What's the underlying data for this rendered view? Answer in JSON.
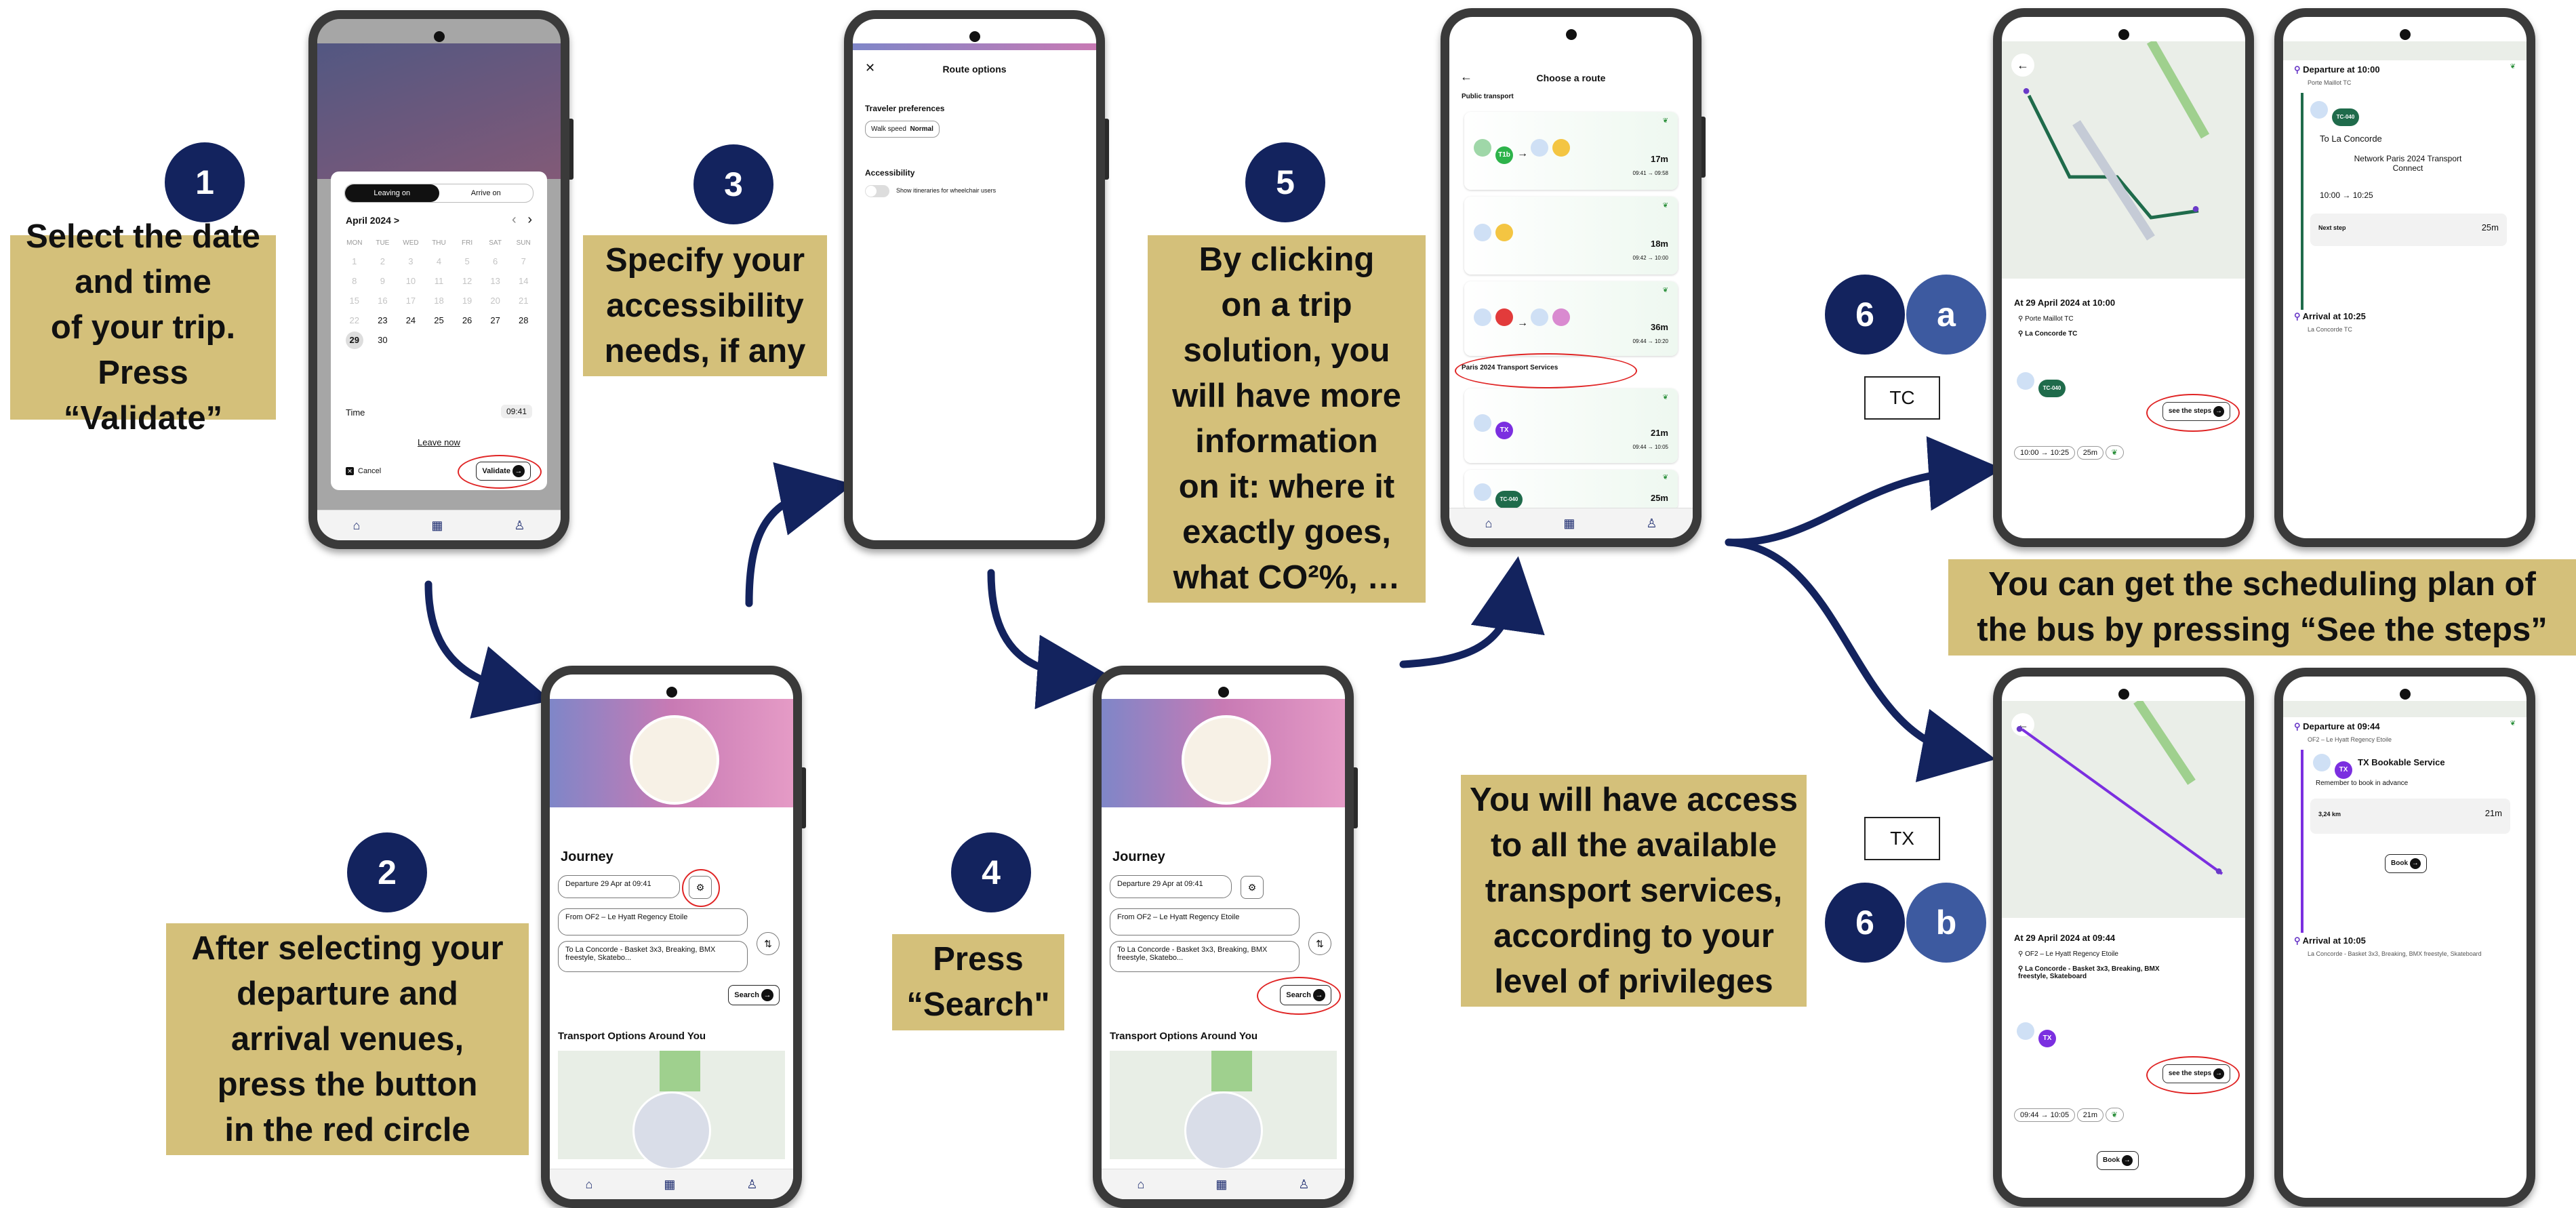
{
  "steps": {
    "s1": {
      "num": "1",
      "text": "Select the date\nand time\nof your trip.\nPress “Validate”"
    },
    "s2": {
      "num": "2",
      "text": "After selecting your\ndeparture and\narrival venues,\npress the button\nin the red circle"
    },
    "s3": {
      "num": "3",
      "text": "Specify your\naccessibility\nneeds, if any"
    },
    "s4": {
      "num": "4",
      "text": "Press\n“Search\""
    },
    "s5": {
      "num": "5",
      "text": "By clicking\non a trip\nsolution, you\nwill have more\ninformation\non it: where it\nexactly goes,\nwhat CO²%, …"
    },
    "s6a": {
      "num": "6",
      "letter": "a",
      "tag": "TC"
    },
    "s6b": {
      "num": "6",
      "letter": "b",
      "tag": "TX"
    },
    "see_steps_note": "You can get the scheduling plan of\nthe bus by pressing “See the steps”",
    "access_note": "You will have access\nto all the available\ntransport services,\naccording to your\nlevel of privileges"
  },
  "phone1": {
    "tab_leaving": "Leaving on",
    "tab_arrive": "Arrive on",
    "month": "April 2024 >",
    "weekdays": [
      "MON",
      "TUE",
      "WED",
      "THU",
      "FRI",
      "SAT",
      "SUN"
    ],
    "days_faded": [
      "1",
      "2",
      "3",
      "4",
      "5",
      "6",
      "7",
      "8",
      "9",
      "10",
      "11",
      "12",
      "13",
      "14",
      "15",
      "16",
      "17",
      "18",
      "19",
      "20",
      "21",
      "22"
    ],
    "days": [
      "23",
      "24",
      "25",
      "26",
      "27",
      "28"
    ],
    "selected_day": "29",
    "last_day": "30",
    "time_label": "Time",
    "time_value": "09:41",
    "leave_now": "Leave now",
    "cancel": "Cancel",
    "validate": "Validate"
  },
  "phone2": {
    "title": "Journey",
    "departure": "Departure  29 Apr at 09:41",
    "from": "From  OF2 – Le Hyatt Regency Etoile",
    "to": "To  La Concorde - Basket 3x3, Breaking, BMX freestyle, Skatebo...",
    "search": "Search",
    "transport_title": "Transport Options Around You"
  },
  "phone3": {
    "title": "Route options",
    "prefs": "Traveler preferences",
    "walk_label": "Walk speed",
    "walk_value": "Normal",
    "accessibility": "Accessibility",
    "wheelchair": "Show itineraries for wheelchair users"
  },
  "phone4": {
    "title": "Journey",
    "departure": "Departure  29 Apr at 09:41",
    "from": "From  OF2 – Le Hyatt Regency Etoile",
    "to": "To  La Concorde - Basket 3x3, Breaking, BMX freestyle, Skatebo...",
    "search": "Search",
    "transport_title": "Transport Options Around You"
  },
  "phone5": {
    "title": "Choose a route",
    "section1": "Public transport",
    "section2": "Paris 2024 Transport Services",
    "routes": [
      {
        "dur": "17m",
        "time": "09:41 → 09:58"
      },
      {
        "dur": "18m",
        "time": "09:42 → 10:00"
      },
      {
        "dur": "36m",
        "time": "09:44 → 10:20"
      },
      {
        "dur": "21m",
        "time": "09:44 → 10:05"
      },
      {
        "dur": "25m"
      }
    ],
    "badges": [
      "T1b",
      "TC-040",
      "TX"
    ]
  },
  "phone6a_map": {
    "date": "At  29 April 2024 at 10:00",
    "from": "Porte Maillot TC",
    "to": "La Concorde TC",
    "badge": "TC-040",
    "see_steps": "see the steps",
    "times": "10:00 → 10:25",
    "dur": "25m"
  },
  "phone6a_steps": {
    "departure": "Departure at 10:00",
    "departure_sub": "Porte Maillot TC",
    "badge": "TC-040",
    "to": "To La Concorde",
    "network": "Network Paris 2024 Transport\nConnect",
    "times": "10:00 → 10:25",
    "next_step": "Next step",
    "dur": "25m",
    "arrival": "Arrival at 10:25",
    "arrival_sub": "La Concorde TC"
  },
  "phone6b_map": {
    "date": "At  29 April 2024 at 09:44",
    "from": "OF2 – Le Hyatt Regency Etoile",
    "to": "La Concorde - Basket 3x3, Breaking, BMX freestyle, Skateboard",
    "see_steps": "see the steps",
    "times": "09:44 → 10:05",
    "dur": "21m",
    "book": "Book"
  },
  "phone6b_steps": {
    "departure": "Departure at 09:44",
    "departure_sub": "OF2 – Le Hyatt Regency Etoile",
    "service": "TX Bookable Service",
    "remember": "Remember to book in advance",
    "distance": "3,24 km",
    "dur": "21m",
    "book": "Book",
    "arrival": "Arrival at 10:05",
    "arrival_sub": "La Concorde - Basket 3x3, Breaking, BMX freestyle, Skateboard"
  },
  "colors": {
    "navy": "#13235e",
    "gold": "#d4c07a",
    "red": "#e02525",
    "purple": "#7b2fe0",
    "green": "#1f6b4b"
  }
}
